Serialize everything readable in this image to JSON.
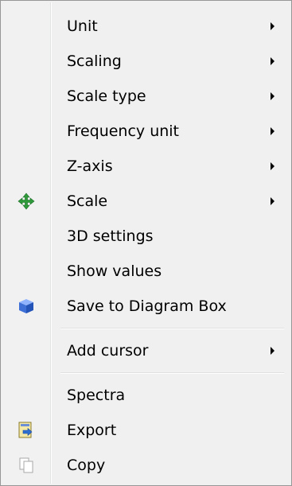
{
  "menu": {
    "items": [
      {
        "label": "Unit",
        "has_submenu": true
      },
      {
        "label": "Scaling",
        "has_submenu": true
      },
      {
        "label": "Scale type",
        "has_submenu": true
      },
      {
        "label": "Frequency unit",
        "has_submenu": true
      },
      {
        "label": "Z-axis",
        "has_submenu": true
      },
      {
        "label": "Scale",
        "has_submenu": true,
        "icon": "scale-arrows-icon"
      },
      {
        "label": "3D settings",
        "has_submenu": false
      },
      {
        "label": "Show values",
        "has_submenu": false
      },
      {
        "label": "Save to Diagram Box",
        "has_submenu": false,
        "icon": "cube-icon"
      },
      {
        "label": "Add cursor",
        "has_submenu": true
      },
      {
        "label": "Spectra",
        "has_submenu": false
      },
      {
        "label": "Export",
        "has_submenu": false,
        "icon": "export-icon"
      },
      {
        "label": "Copy",
        "has_submenu": false,
        "icon": "copy-icon"
      }
    ]
  },
  "colors": {
    "background": "#f0f0f0",
    "border": "#979797",
    "scale_icon": "#2e9a3a",
    "cube_icon": "#3d6fd6"
  }
}
